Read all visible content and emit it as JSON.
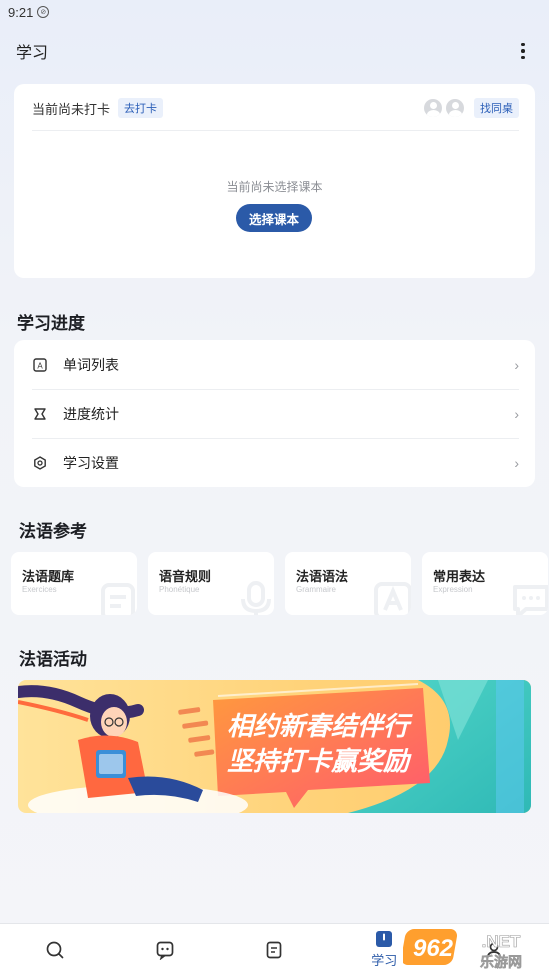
{
  "status_bar": {
    "time": "9:21",
    "notif_icon": "notification-icon"
  },
  "header": {
    "title": "学习",
    "more_icon": "more-vertical-icon"
  },
  "checkin": {
    "status_text": "当前尚未打卡",
    "go_checkin_label": "去打卡",
    "find_desk_label": "找同桌",
    "empty_text": "当前尚未选择课本",
    "choose_book_label": "选择课本"
  },
  "progress": {
    "title": "学习进度",
    "items": [
      {
        "label": "单词列表",
        "icon": "word-list-icon"
      },
      {
        "label": "进度统计",
        "icon": "progress-stats-icon"
      },
      {
        "label": "学习设置",
        "icon": "settings-icon"
      }
    ]
  },
  "reference": {
    "title": "法语参考",
    "items": [
      {
        "label": "法语题库",
        "sub": "Exercices",
        "icon": "document-icon"
      },
      {
        "label": "语音规则",
        "sub": "Phonétique",
        "icon": "microphone-icon"
      },
      {
        "label": "法语语法",
        "sub": "Grammaire",
        "icon": "letter-a-icon"
      },
      {
        "label": "常用表达",
        "sub": "Expression",
        "icon": "chat-bubble-icon"
      }
    ]
  },
  "activity": {
    "title": "法语活动",
    "banner_line1": "相约新春结伴行",
    "banner_line2": "坚持打卡赢奖励"
  },
  "tabbar": {
    "items": [
      {
        "icon": "search-icon",
        "label": ""
      },
      {
        "icon": "chat-icon",
        "label": ""
      },
      {
        "icon": "notes-icon",
        "label": ""
      },
      {
        "icon": "study-icon",
        "label": "学习"
      },
      {
        "icon": "profile-icon",
        "label": ""
      }
    ]
  },
  "watermark": {
    "text1": "962",
    "text2": ".NET",
    "text3": "乐游网"
  },
  "colors": {
    "accent": "#2b5aa8",
    "background": "#f1f3f8"
  }
}
